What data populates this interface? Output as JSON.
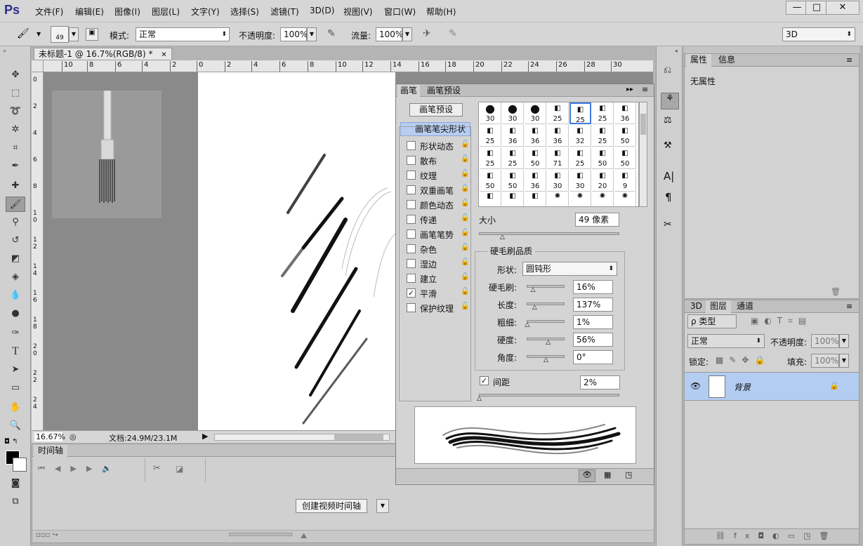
{
  "app": {
    "logo": "Ps"
  },
  "menu": [
    "文件(F)",
    "编辑(E)",
    "图像(I)",
    "图层(L)",
    "文字(Y)",
    "选择(S)",
    "滤镜(T)",
    "3D(D)",
    "视图(V)",
    "窗口(W)",
    "帮助(H)"
  ],
  "window_controls": {
    "minimize": "—",
    "maximize": "□",
    "close": "✕"
  },
  "options": {
    "brush_size": "49",
    "mode_label": "模式:",
    "mode_value": "正常",
    "opacity_label": "不透明度:",
    "opacity_value": "100%",
    "flow_label": "流量:",
    "flow_value": "100%",
    "workspace": "3D"
  },
  "document": {
    "tab_title": "未标题-1 @ 16.7%(RGB/8) *",
    "tab_close": "✕",
    "ruler_h_ticks": [
      "10",
      "8",
      "6",
      "4",
      "2",
      "0",
      "2",
      "4",
      "6",
      "8",
      "10",
      "12",
      "14",
      "16",
      "18",
      "20",
      "22",
      "24",
      "26",
      "28",
      "30"
    ],
    "ruler_v_ticks": [
      "0",
      "2",
      "4",
      "6",
      "8",
      "1 0",
      "1 2",
      "1 4",
      "1 6",
      "1 8",
      "2 0",
      "2 2",
      "2 4"
    ],
    "zoom": "16.67%",
    "doc_info": "文档:24.9M/23.1M"
  },
  "timeline": {
    "tab": "时间轴",
    "create_button": "创建视频时间轴"
  },
  "brush_panel": {
    "tabs": [
      "画笔",
      "画笔预设"
    ],
    "preset_button": "画笔预设",
    "selected_item": "画笔笔尖形状",
    "options": [
      {
        "label": "形状动态",
        "checked": false
      },
      {
        "label": "散布",
        "checked": false
      },
      {
        "label": "纹理",
        "checked": false
      },
      {
        "label": "双重画笔",
        "checked": false
      },
      {
        "label": "颜色动态",
        "checked": false
      },
      {
        "label": "传递",
        "checked": false
      },
      {
        "label": "画笔笔势",
        "checked": false
      },
      {
        "label": "杂色",
        "checked": false
      },
      {
        "label": "湿边",
        "checked": false
      },
      {
        "label": "建立",
        "checked": false
      },
      {
        "label": "平滑",
        "checked": true
      },
      {
        "label": "保护纹理",
        "checked": false
      }
    ],
    "tip_sizes": [
      [
        "30",
        "30",
        "30",
        "25",
        "25",
        "25",
        "36"
      ],
      [
        "25",
        "36",
        "36",
        "36",
        "32",
        "25",
        "50"
      ],
      [
        "25",
        "25",
        "50",
        "71",
        "25",
        "50",
        "50"
      ],
      [
        "50",
        "50",
        "36",
        "30",
        "30",
        "20",
        "9"
      ]
    ],
    "size_label": "大小",
    "size_value": "49 像素",
    "size_fraction": 0.17,
    "bristle_group": "硬毛刷品质",
    "shape_label": "形状:",
    "shape_value": "圆钝形",
    "params": [
      {
        "label": "硬毛刷:",
        "value": "16%",
        "level": 0.16
      },
      {
        "label": "长度:",
        "value": "137%",
        "level": 0.2
      },
      {
        "label": "粗细:",
        "value": "1%",
        "level": 0.01
      },
      {
        "label": "硬度:",
        "value": "56%",
        "level": 0.56
      },
      {
        "label": "角度:",
        "value": "0°",
        "level": 0.5
      }
    ],
    "spacing_label": "间距",
    "spacing_checked": true,
    "spacing_value": "2%"
  },
  "properties": {
    "tabs": [
      "属性",
      "信息"
    ],
    "content": "无属性"
  },
  "layers": {
    "tabs": [
      "3D",
      "图层",
      "通道"
    ],
    "filter": "ρ 类型",
    "blend": "正常",
    "opacity_label": "不透明度:",
    "opacity_value": "100%",
    "lock_label": "锁定:",
    "fill_label": "填充:",
    "fill_value": "100%",
    "layer_name": "背景"
  }
}
